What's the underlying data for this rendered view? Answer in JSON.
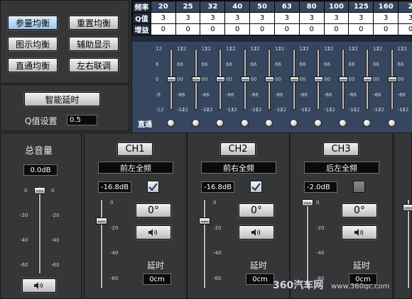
{
  "left_buttons": [
    "参量均衡",
    "重置均衡",
    "图示均衡",
    "辅助显示",
    "直通均衡",
    "左右联调"
  ],
  "delay_box": {
    "smart_delay_label": "智能延时",
    "q_label": "Q值设置",
    "q_value": "0.5"
  },
  "eq": {
    "row_labels": [
      "频率",
      "Q值",
      "增益"
    ],
    "freqs": [
      "20",
      "25",
      "32",
      "40",
      "50",
      "63",
      "80",
      "100",
      "125",
      "160",
      "2"
    ],
    "q": [
      "3",
      "3",
      "3",
      "3",
      "3",
      "3",
      "3",
      "3",
      "3",
      "3",
      "3"
    ],
    "gain": [
      "0",
      "0",
      "0",
      "0",
      "0",
      "0",
      "0",
      "0",
      "0",
      "0",
      "0"
    ],
    "scale": [
      "12",
      "6",
      "0",
      "-6",
      "-12"
    ],
    "bypass_label": "直通"
  },
  "master": {
    "title": "总音量",
    "value": "0.0dB",
    "scale": [
      "0",
      "-20",
      "-40",
      "-60"
    ],
    "level_db": 0
  },
  "scale_ch": [
    "0",
    "-20",
    "-40",
    "-60"
  ],
  "channels": [
    {
      "name": "CH1",
      "source": "前左全频",
      "value": "-16.8dB",
      "checked": true,
      "phase": "0°",
      "delay_label": "延时",
      "delay": "0cm",
      "level_db": -16.8
    },
    {
      "name": "CH2",
      "source": "前右全频",
      "value": "-16.8dB",
      "checked": true,
      "phase": "0°",
      "delay_label": "延时",
      "delay": "0cm",
      "level_db": -16.8
    },
    {
      "name": "CH3",
      "source": "后左全频",
      "value": "-2.0dB",
      "checked": false,
      "phase": "0°",
      "delay_label": "延时",
      "delay": "0cm",
      "level_db": -2.0
    }
  ],
  "watermark": {
    "brand": "360汽车网",
    "url": "www.360qc.com"
  },
  "colors": {
    "panel": "#353638",
    "field": "#0b0b0b",
    "accent_active": "#9fc4ea"
  }
}
